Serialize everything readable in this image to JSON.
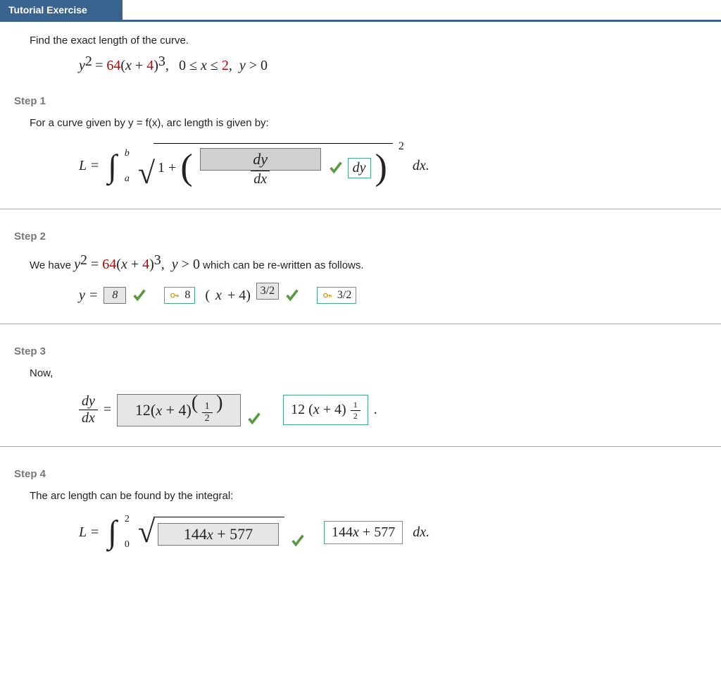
{
  "banner": "Tutorial Exercise",
  "prompt": "Find the exact length of the curve.",
  "curve": {
    "lhs": "y",
    "eq_coeff": "64",
    "eq_inner_const": "4",
    "range": "0 ≤ x ≤ 2,  y > 0"
  },
  "step1": {
    "label": "Step 1",
    "text": "For a curve given by y = f(x), arc length is given by:",
    "L": "L =",
    "int_upper": "b",
    "int_lower": "a",
    "one_plus": "1 +",
    "input_num": "dy",
    "frac_den": "dx",
    "sq": "2",
    "key": "dy",
    "tail": "dx."
  },
  "step2": {
    "label": "Step 2",
    "text_pre": "We have  ",
    "text_post": " which can be re-written as follows.",
    "y_eq": "y =",
    "ans1": "8",
    "key1": "8",
    "middle": "(x + 4)",
    "ans2": "3/2",
    "key2": "3/2"
  },
  "step3": {
    "label": "Step 3",
    "text": "Now,",
    "lhs_num": "dy",
    "lhs_den": "dx",
    "eq": "=",
    "input": "12(x + 4)",
    "input_exp_num": "1",
    "input_exp_den": "2",
    "key_base": "12 (x + 4)",
    "key_exp_num": "1",
    "key_exp_den": "2",
    "period": "."
  },
  "step4": {
    "label": "Step 4",
    "text": "The arc length can be found by the integral:",
    "L": "L =",
    "int_upper": "2",
    "int_lower": "0",
    "input": "144x + 577",
    "key": "144x + 577",
    "tail": "dx."
  }
}
